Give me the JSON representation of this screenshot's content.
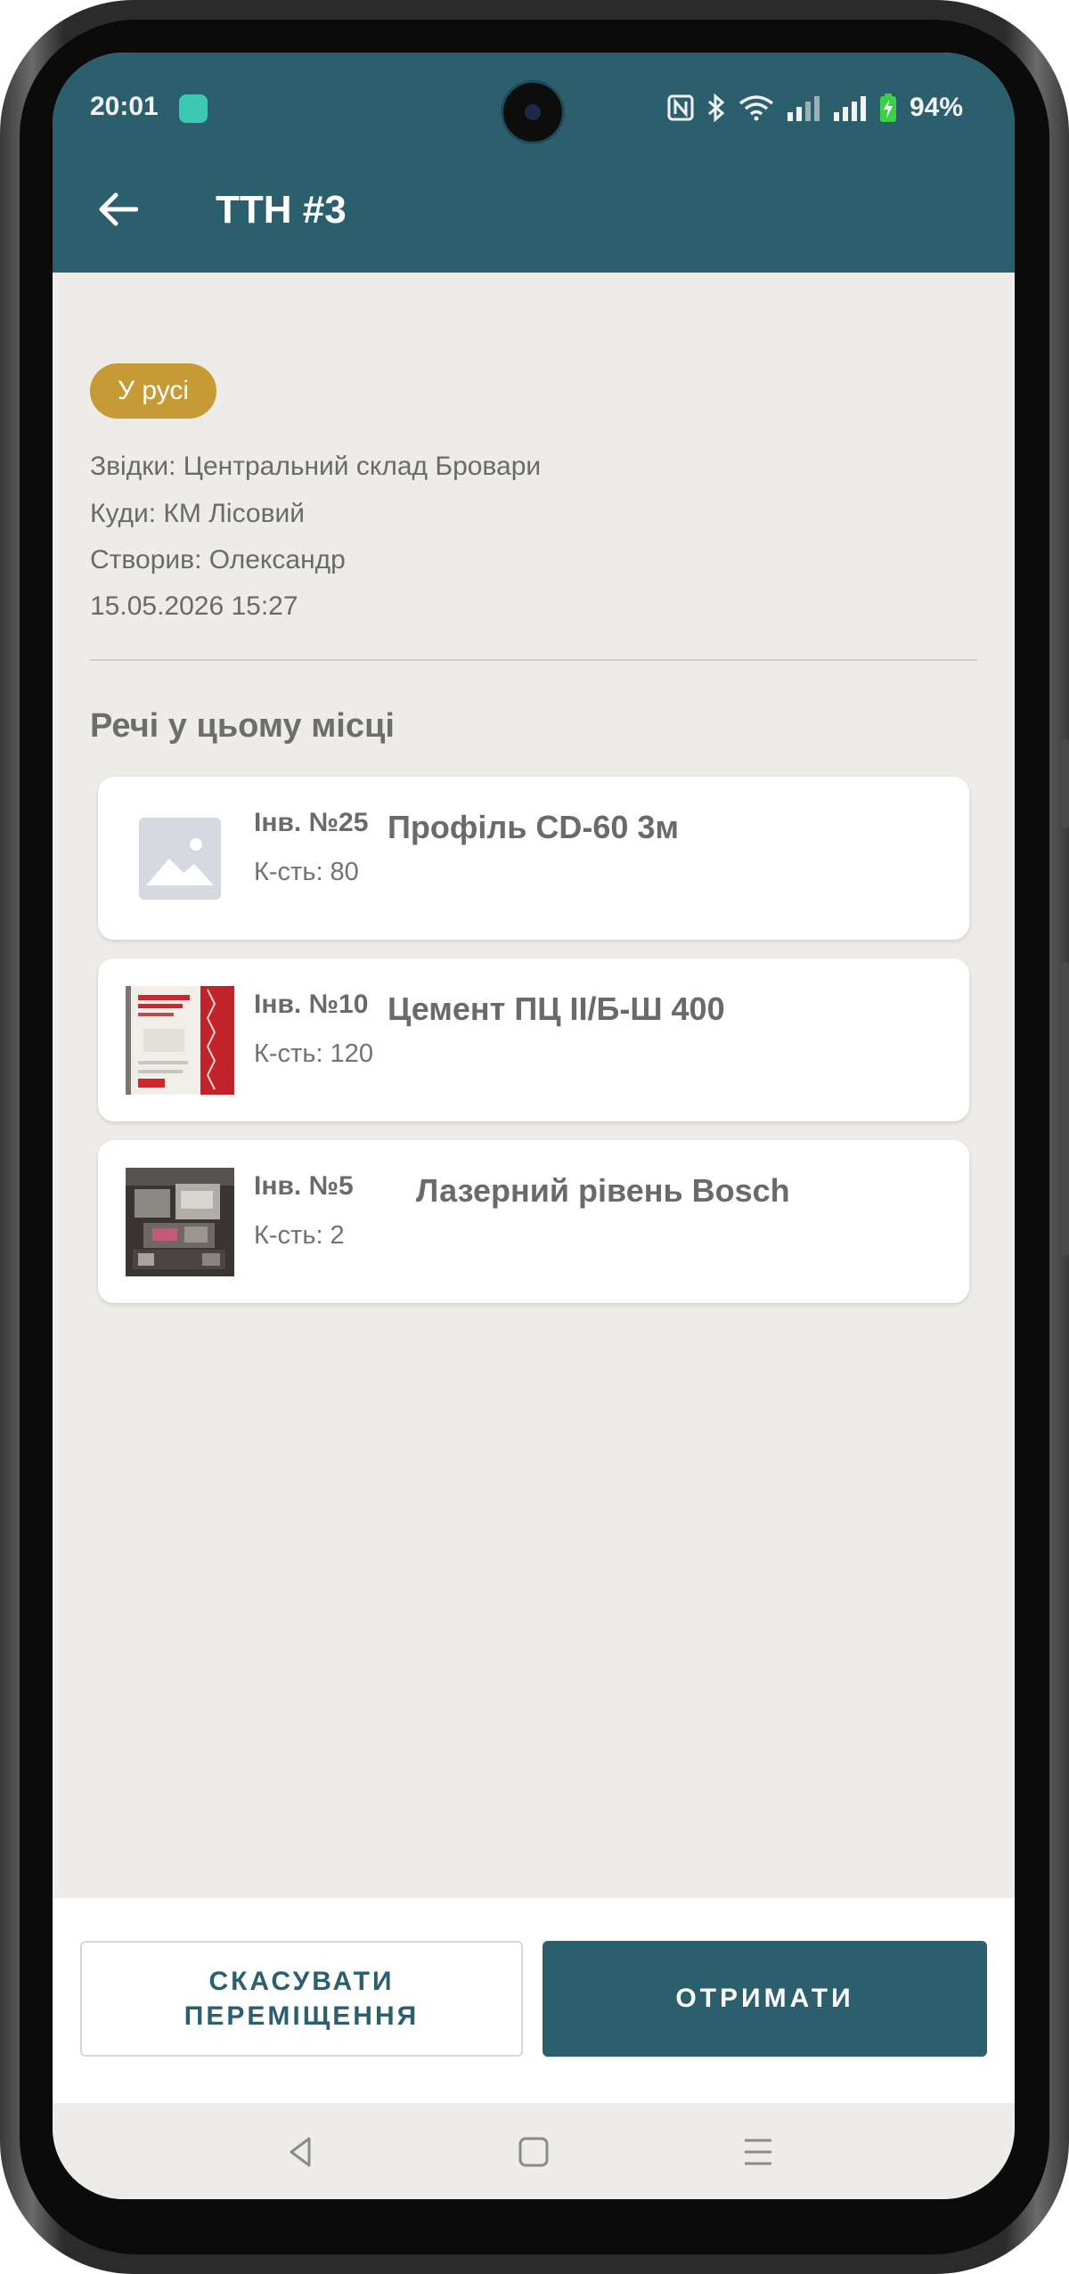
{
  "status_bar": {
    "time": "20:01",
    "battery": "94%",
    "icons": [
      "notification-app-icon",
      "nfc-icon",
      "bluetooth-icon",
      "wifi-icon",
      "signal-icon",
      "signal-icon",
      "battery-charging-icon"
    ]
  },
  "header": {
    "title": "ТТН #3",
    "back_icon": "arrow-left-icon"
  },
  "shipment": {
    "status": "У русі",
    "from": "Звідки: Центральний склад Бровари",
    "to": "Куди: КМ Лісовий",
    "created_by": "Створив: Олександр",
    "datetime": "15.05.2026 15:27"
  },
  "items_section": {
    "title": "Речі у цьому місці",
    "items": [
      {
        "inv": "Інв. №25",
        "name": "Профіль CD-60 3м",
        "qty": "К-сть: 80",
        "image": "placeholder-image-icon"
      },
      {
        "inv": "Інв. №10",
        "name": "Цемент ПЦ II/Б-Ш 400",
        "qty": "К-сть: 120",
        "image": "cement-bag-photo"
      },
      {
        "inv": "Інв. №5",
        "name": "Лазерний рівень Bosch",
        "qty": "К-сть: 2",
        "image": "laser-level-photo"
      }
    ]
  },
  "actions": {
    "cancel": "СКАСУВАТИ\nПЕРЕМІЩЕННЯ",
    "receive": "ОТРИМАТИ"
  },
  "nav": {
    "back": "nav-back-icon",
    "home": "nav-home-icon",
    "menu": "nav-menu-icon"
  },
  "colors": {
    "primary": "#2b5f6d",
    "badge": "#c69a34",
    "background": "#eeece8"
  }
}
